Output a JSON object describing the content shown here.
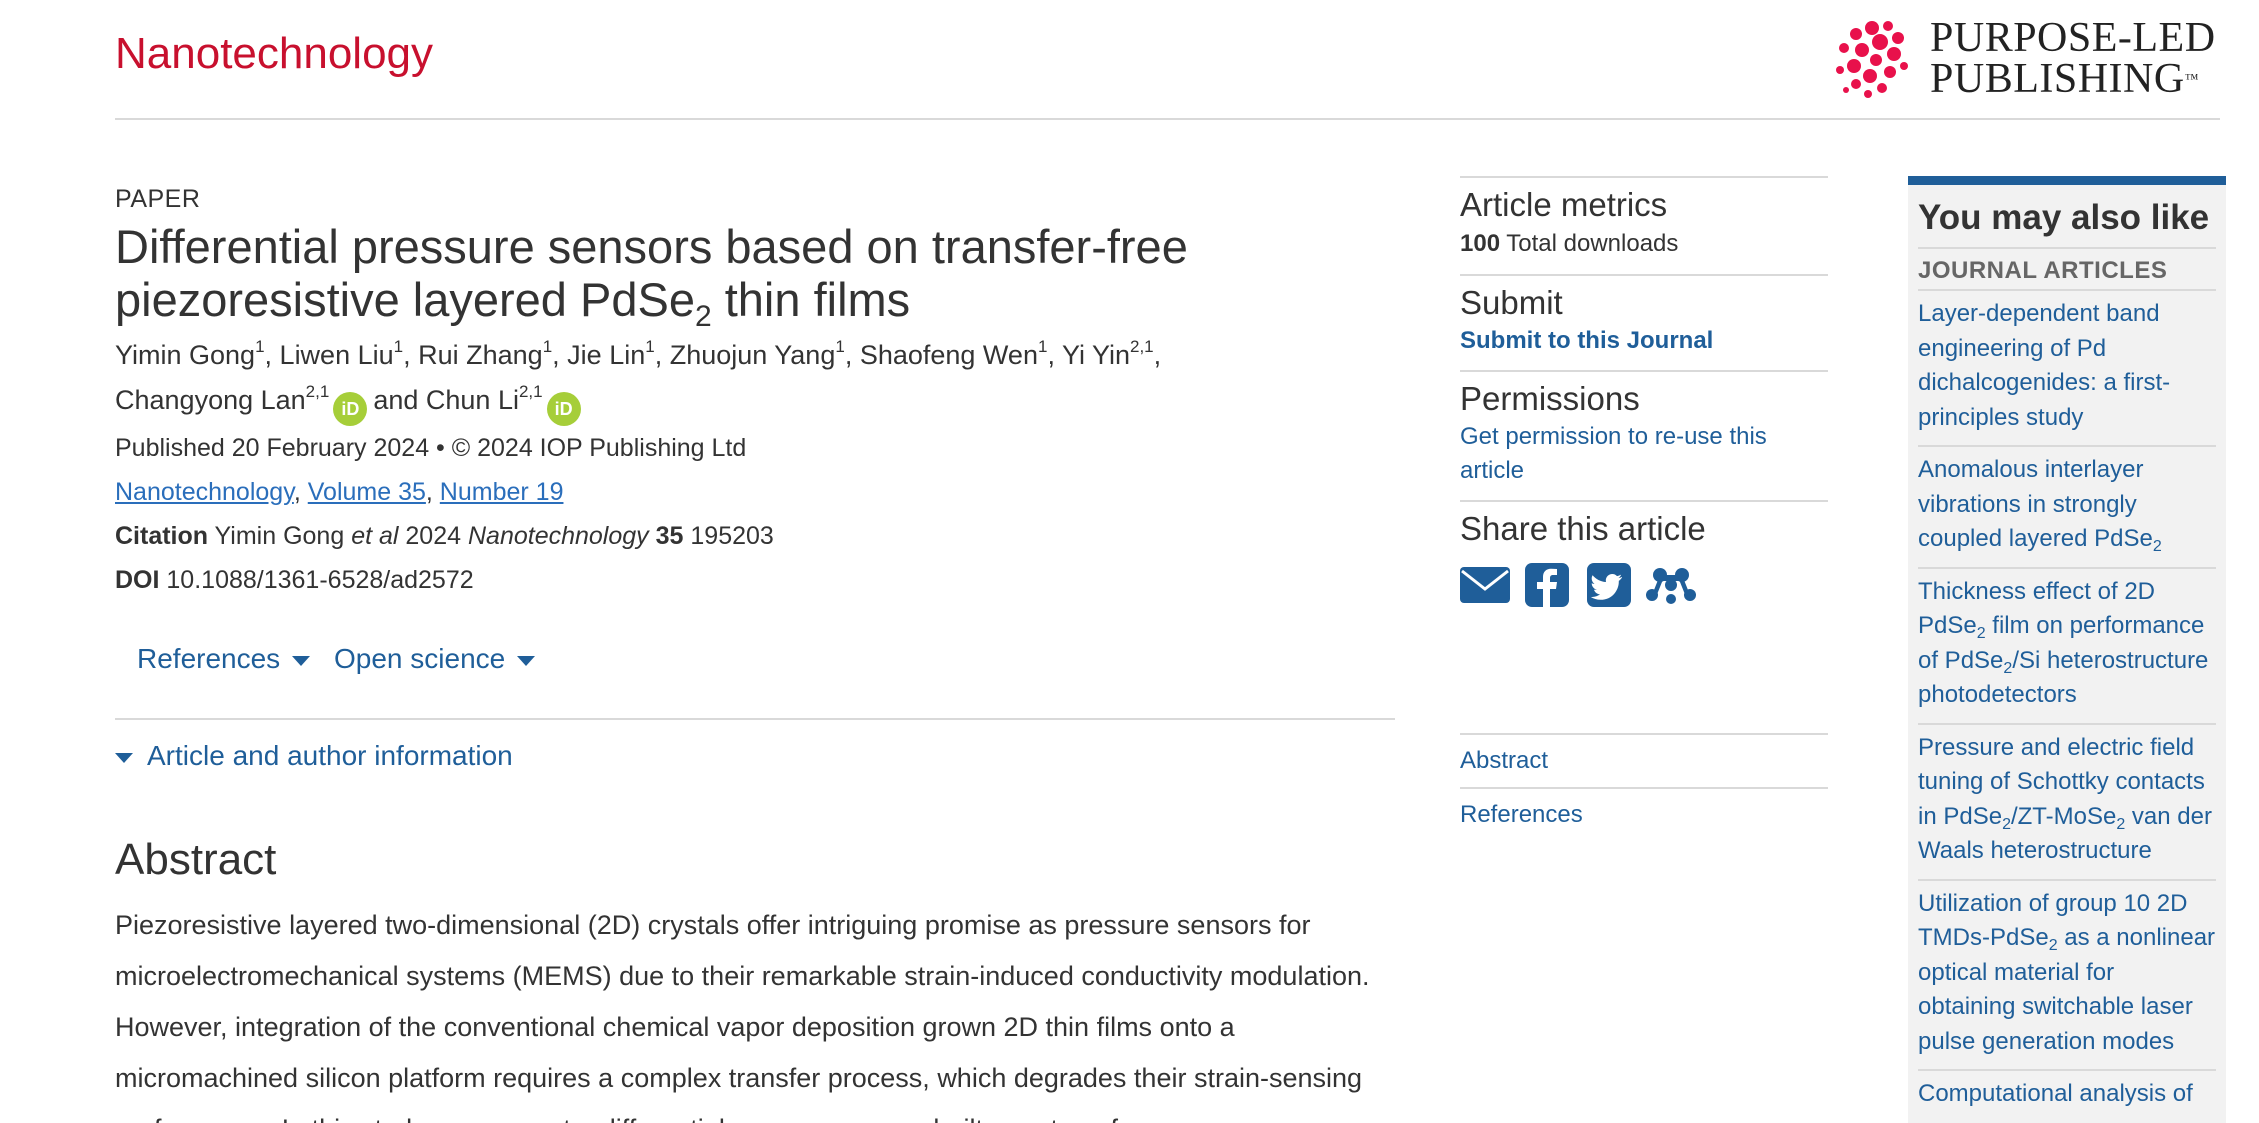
{
  "header": {
    "journal_name": "Nanotechnology",
    "brand_line1": "PURPOSE-LED",
    "brand_line2": "PUBLISHING",
    "brand_tm": "™"
  },
  "article": {
    "type": "PAPER",
    "title_pre": "Differential pressure sensors based on transfer-free piezoresistive layered PdSe",
    "title_sub": "2",
    "title_post": " thin films",
    "authors": [
      {
        "name": "Yimin Gong",
        "aff": "1",
        "sep": ", "
      },
      {
        "name": "Liwen Liu",
        "aff": "1",
        "sep": ", "
      },
      {
        "name": "Rui Zhang",
        "aff": "1",
        "sep": ", "
      },
      {
        "name": "Jie Lin",
        "aff": "1",
        "sep": ", "
      },
      {
        "name": "Zhuojun Yang",
        "aff": "1",
        "sep": ", "
      },
      {
        "name": "Shaofeng Wen",
        "aff": "1",
        "sep": ", "
      },
      {
        "name": "Yi Yin",
        "aff": "2,1",
        "sep": ","
      },
      {
        "name": "Changyong Lan",
        "aff": "2,1",
        "sep": ""
      },
      {
        "name": "Chun Li",
        "aff": "2,1",
        "sep": ""
      }
    ],
    "and_word": "and",
    "orcid_label": "iD",
    "published": "Published 20 February 2024 • © 2024 IOP Publishing Ltd",
    "journal_link": "Nanotechnology",
    "volume_link": "Volume 35",
    "number_link": "Number 19",
    "citation_label": "Citation",
    "citation_authors": "Yimin Gong",
    "citation_etal": "et al",
    "citation_year": "2024",
    "citation_journal": "Nanotechnology",
    "citation_volume": "35",
    "citation_page": "195203",
    "doi_label": "DOI",
    "doi_value": "10.1088/1361-6528/ad2572"
  },
  "tabs": {
    "references": "References",
    "open_science": "Open science"
  },
  "accordion": {
    "label": "Article and author information"
  },
  "abstract": {
    "heading": "Abstract",
    "text": "Piezoresistive layered two-dimensional (2D) crystals offer intriguing promise as pressure sensors for microelectromechanical systems (MEMS) due to their remarkable strain-induced conductivity modulation. However, integration of the conventional chemical vapor deposition grown 2D thin films onto a micromachined silicon platform requires a complex transfer process, which degrades their strain-sensing performance. In this study, we present a differential pressure sensor built on a transfer"
  },
  "metrics": {
    "metrics_title": "Article metrics",
    "downloads_count": "100",
    "downloads_label": "Total downloads",
    "submit_title": "Submit",
    "submit_link": "Submit to this Journal",
    "permissions_title": "Permissions",
    "permissions_link": "Get permission to re-use this article",
    "share_title": "Share this article",
    "share_icons": [
      "email-icon",
      "facebook-icon",
      "twitter-icon",
      "mendeley-icon"
    ]
  },
  "side_nav": {
    "abstract": "Abstract",
    "references": "References"
  },
  "related": {
    "title": "You may also like",
    "subtitle": "JOURNAL ARTICLES",
    "items": [
      {
        "pre": "Layer-dependent band engineering of Pd dichalcogenides: a first-principles study",
        "sub": "",
        "mid": "",
        "sub2": "",
        "post": ""
      },
      {
        "pre": "Anomalous interlayer vibrations in strongly coupled layered PdSe",
        "sub": "2",
        "mid": "",
        "sub2": "",
        "post": ""
      },
      {
        "pre": "Thickness effect of 2D PdSe",
        "sub": "2",
        "mid": " film on performance of PdSe",
        "sub2": "2",
        "post": "/Si heterostructure photodetectors"
      },
      {
        "pre": "Pressure and electric field tuning of Schottky contacts in PdSe",
        "sub": "2",
        "mid": "/ZT-MoSe",
        "sub2": "2",
        "post": " van der Waals heterostructure"
      },
      {
        "pre": "Utilization of group 10 2D TMDs-PdSe",
        "sub": "2",
        "mid": " as a nonlinear optical material for obtaining switchable laser pulse generation modes",
        "sub2": "",
        "post": ""
      },
      {
        "pre": "Computational analysis of",
        "sub": "",
        "mid": "",
        "sub2": "",
        "post": ""
      }
    ]
  },
  "colors": {
    "journal_red": "#c8102e",
    "link_blue": "#1f5e99",
    "orcid_green": "#a6ce39",
    "related_bg": "#f2f2f2"
  }
}
